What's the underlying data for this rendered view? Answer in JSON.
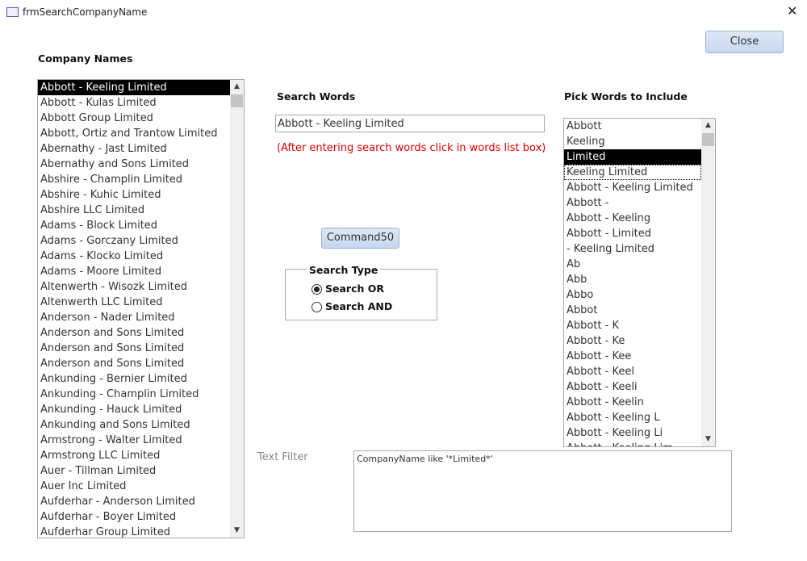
{
  "window": {
    "title": "frmSearchCompanyName",
    "icon": "form-icon",
    "close": "✕"
  },
  "close_button": "Close",
  "company_names": {
    "label": "Company Names",
    "items": [
      "Abbott - Keeling Limited",
      "Abbott - Kulas Limited",
      "Abbott Group Limited",
      "Abbott, Ortiz and Trantow Limited",
      "Abernathy - Jast Limited",
      "Abernathy and Sons Limited",
      "Abshire - Champlin Limited",
      "Abshire - Kuhic Limited",
      "Abshire LLC Limited",
      "Adams - Block Limited",
      "Adams - Gorczany Limited",
      "Adams - Klocko Limited",
      "Adams - Moore Limited",
      "Altenwerth - Wisozk Limited",
      "Altenwerth LLC Limited",
      "Anderson - Nader Limited",
      "Anderson and Sons Limited",
      "Anderson and Sons Limited",
      "Anderson and Sons Limited",
      "Ankunding - Bernier Limited",
      "Ankunding - Champlin Limited",
      "Ankunding - Hauck Limited",
      "Ankunding and Sons Limited",
      "Armstrong - Walter Limited",
      "Armstrong LLC Limited",
      "Auer - Tillman Limited",
      "Auer Inc Limited",
      "Aufderhar - Anderson Limited",
      "Aufderhar - Boyer Limited",
      "Aufderhar Group Limited"
    ],
    "selected": 0
  },
  "search_words": {
    "label": "Search Words",
    "value": "Abbott - Keeling Limited",
    "hint": "(After entering search words click in words list box)",
    "hint_color": "#e00000"
  },
  "command_button": "Command50",
  "search_type": {
    "label": "Search Type",
    "options": [
      "Search OR",
      "Search AND"
    ],
    "selected": 0
  },
  "pick_words": {
    "label": "Pick Words to Include",
    "items": [
      "Abbott",
      "Keeling",
      "Limited",
      "Keeling Limited",
      "Abbott - Keeling Limited",
      "Abbott -",
      "Abbott - Keeling",
      "Abbott -  Limited",
      "- Keeling Limited",
      "Ab",
      "Abb",
      "Abbo",
      "Abbot",
      "Abbott - K",
      "Abbott - Ke",
      "Abbott - Kee",
      "Abbott - Keel",
      "Abbott - Keeli",
      "Abbott - Keelin",
      "Abbott - Keeling L",
      "Abbott - Keeling Li",
      "Abbott - Keeling Lim"
    ],
    "selected": 2,
    "focused": 3
  },
  "text_filter": {
    "label": "Text Filter",
    "value": "CompanyName like '*Limited*'"
  }
}
